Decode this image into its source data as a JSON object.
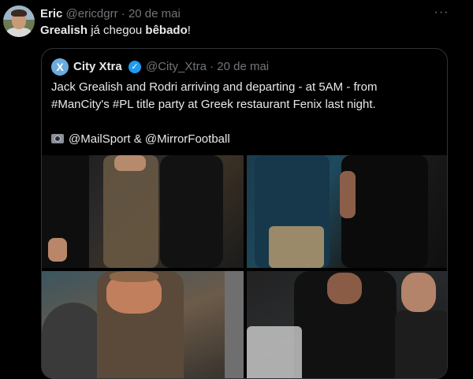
{
  "tweet": {
    "author_name": "Eric",
    "author_handle": "@ericdgrr",
    "separator": "·",
    "date": "20 de mai",
    "more_label": "···",
    "text_part1": "Grealish",
    "text_part2": " já chegou ",
    "text_part3": "bêbado",
    "text_part4": "!"
  },
  "quote": {
    "avatar_label": "X",
    "author_name": "City Xtra",
    "verified_label": "✓",
    "author_handle": "@City_Xtra",
    "separator": "·",
    "date": "20 de mai",
    "line1": "Jack Grealish and Rodri arriving and departing - at 5AM - from",
    "line2": "#ManCity's #PL title party at Greek restaurant Fenix last night.",
    "credits": "@MailSport & @MirrorFootball"
  },
  "colors": {
    "background": "#000000",
    "text": "#e7e9ea",
    "muted": "#71767b",
    "border": "#2f3336",
    "verified": "#1d9bf0"
  },
  "icons": {
    "more": "more-options-icon",
    "verified": "verified-badge-icon",
    "camera": "camera-icon"
  }
}
